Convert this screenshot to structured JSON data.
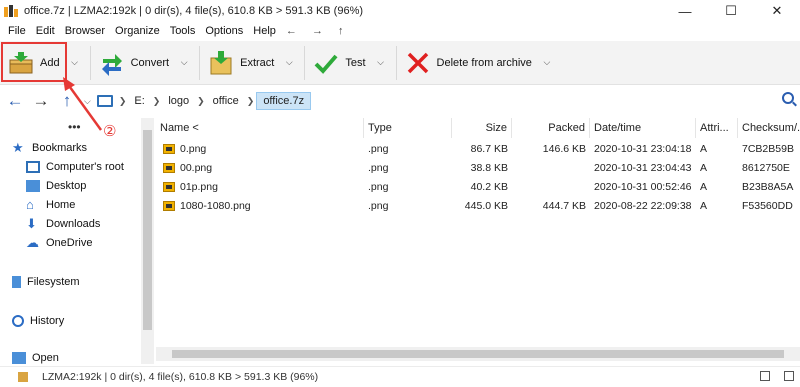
{
  "window": {
    "title": "office.7z | LZMA2:192k | 0 dir(s), 4 file(s), 610.8 KB > 591.3 KB (96%)"
  },
  "menu": [
    "File",
    "Edit",
    "Browser",
    "Organize",
    "Tools",
    "Options",
    "Help"
  ],
  "menu_extra": "← → ↑",
  "toolbar": {
    "add": "Add",
    "convert": "Convert",
    "extract": "Extract",
    "test": "Test",
    "delete": "Delete from archive"
  },
  "address": {
    "crumbs": [
      "E:",
      "logo",
      "office",
      "office.7z"
    ]
  },
  "nav": {
    "bookmarks": "Bookmarks",
    "computers_root": "Computer's root",
    "desktop": "Desktop",
    "home": "Home",
    "downloads": "Downloads",
    "onedrive": "OneDrive",
    "filesystem": "Filesystem",
    "history": "History",
    "open": "Open"
  },
  "table": {
    "headers": [
      "Name <",
      "Type",
      "Size",
      "Packed",
      "Date/time",
      "Attri...",
      "Checksum/..."
    ],
    "rows": [
      {
        "name": "0.png",
        "type": ".png",
        "size": "86.7 KB",
        "packed": "146.6 KB",
        "date": "2020-10-31 23:04:18",
        "attr": "A",
        "checksum": "7CB2B59B"
      },
      {
        "name": "00.png",
        "type": ".png",
        "size": "38.8 KB",
        "packed": "",
        "date": "2020-10-31 23:04:43",
        "attr": "A",
        "checksum": "8612750E"
      },
      {
        "name": "01p.png",
        "type": ".png",
        "size": "40.2 KB",
        "packed": "",
        "date": "2020-10-31 00:52:46",
        "attr": "A",
        "checksum": "B23B8A5A"
      },
      {
        "name": "1080-1080.png",
        "type": ".png",
        "size": "445.0 KB",
        "packed": "444.7 KB",
        "date": "2020-08-22 22:09:38",
        "attr": "A",
        "checksum": "F53560DD"
      }
    ]
  },
  "status": {
    "text": "LZMA2:192k | 0 dir(s), 4 file(s), 610.8 KB > 591.3 KB (96%)"
  },
  "annotation": {
    "number": "②"
  },
  "colors": {
    "highlight": "#e53935",
    "selected_crumb": "#cce4f7",
    "nav_blue": "#2a5db0"
  }
}
